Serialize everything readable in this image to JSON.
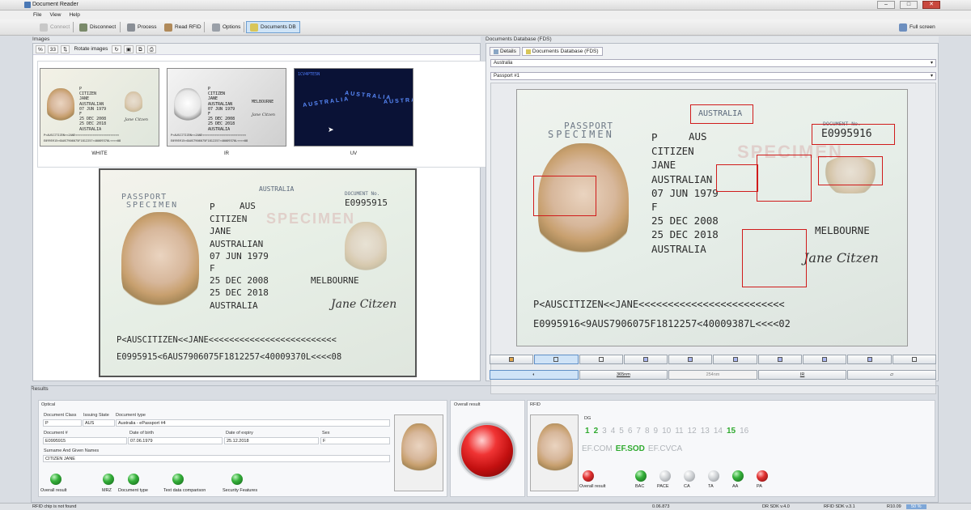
{
  "window": {
    "title": "Document Reader"
  },
  "menu": [
    "File",
    "View",
    "Help"
  ],
  "toolbar": {
    "connect": "Connect",
    "disconnect": "Disconnect",
    "process": "Process",
    "read_rfid": "Read RFID",
    "options": "Options",
    "documents_db": "Documents DB",
    "full_screen": "Full screen"
  },
  "images_panel": {
    "title": "Images",
    "tools": {
      "percent": "%",
      "zoom": "33",
      "rotate": "Rotate images"
    },
    "thumbnails": [
      {
        "caption": "WHITE"
      },
      {
        "caption": "IR"
      },
      {
        "caption": "UV"
      }
    ]
  },
  "passport": {
    "header": "PASSPORT",
    "specimen": "SPECIMEN",
    "country_box": "AUSTRALIA",
    "doc_no_label": "DOCUMENT No.",
    "type": "P",
    "issuing": "AUS",
    "surname": "CITIZEN",
    "given": "JANE",
    "nationality": "AUSTRALIAN",
    "dob": "07 JUN 1979",
    "sex": "F",
    "issue": "25 DEC 2008",
    "expiry": "25 DEC 2018",
    "authority": "AUSTRALIA",
    "birthplace": "MELBOURNE",
    "signature": "Jane Citzen",
    "watermark": "SPECIMEN",
    "uv_text": "AUSTRALIA",
    "uv_code": "1CV4PTE5N"
  },
  "passport_main": {
    "doc_no": "E0995915",
    "mrz1": "P<AUSCITIZEN<<JANE<<<<<<<<<<<<<<<<<<<<<<<<<",
    "mrz2": "E0995915<6AUS7906075F1812257<40009370L<<<<08"
  },
  "passport_db": {
    "doc_no": "E0995916",
    "mrz1": "P<AUSCITIZEN<<JANE<<<<<<<<<<<<<<<<<<<<<<<<<",
    "mrz2": "E0995916<9AUS7906075F1812257<40009387L<<<<02"
  },
  "db_panel": {
    "title": "Documents Database (FDS)",
    "tab_details": "Details",
    "tab_fds": "Documents Database (FDS)",
    "country": "Australia",
    "document": "Passport #1",
    "light_buttons": [
      "365nm",
      "254nm",
      "IR"
    ]
  },
  "results": {
    "title": "Results",
    "optical": {
      "title": "Optical",
      "doc_class_label": "Document Class",
      "issuing_state_label": "Issuing State",
      "doc_type_label": "Document type",
      "doc_class": "P",
      "issuing_state": "AUS",
      "doc_type": "Australia - ePassport #4",
      "doc_no_label": "Document #",
      "dob_label": "Date of birth",
      "expiry_label": "Date of expiry",
      "sex_label": "Sex",
      "doc_no": "E0995915",
      "dob": "07.06.1979",
      "expiry": "25.12.2018",
      "sex": "F",
      "name_label": "Surname And Given Names",
      "name": "CITIZEN JANE",
      "indicators": [
        "Overall result",
        "MRZ",
        "Document type",
        "Text data comparison",
        "Security Features"
      ]
    },
    "overall": {
      "title": "Overall result"
    },
    "rfid": {
      "title": "RFID",
      "dg_label": "DG",
      "dg": [
        {
          "n": "1",
          "on": true
        },
        {
          "n": "2",
          "on": true
        },
        {
          "n": "3",
          "on": false
        },
        {
          "n": "4",
          "on": false
        },
        {
          "n": "5",
          "on": false
        },
        {
          "n": "6",
          "on": false
        },
        {
          "n": "7",
          "on": false
        },
        {
          "n": "8",
          "on": false
        },
        {
          "n": "9",
          "on": false
        },
        {
          "n": "10",
          "on": false
        },
        {
          "n": "11",
          "on": false
        },
        {
          "n": "12",
          "on": false
        },
        {
          "n": "13",
          "on": false
        },
        {
          "n": "14",
          "on": false
        },
        {
          "n": "15",
          "on": true
        },
        {
          "n": "16",
          "on": false
        }
      ],
      "ef": [
        {
          "t": "EF.COM",
          "on": false
        },
        {
          "t": "EF.SOD",
          "on": true
        },
        {
          "t": "EF.CVCA",
          "on": false
        }
      ],
      "indicators": [
        "Overall result",
        "BAC",
        "PACE",
        "CA",
        "TA",
        "AA",
        "PA"
      ]
    }
  },
  "status": {
    "message": "RFID chip is not found",
    "time": "0.06.873",
    "dr_sdk": "DR SDK v.4.0",
    "rfid_sdk": "RFID SDK v.3.1",
    "rfid_ver": "R10.09",
    "percent": "50 %"
  },
  "colors": {
    "ok": "#2faa2f",
    "fail": "#d01b1b",
    "accent": "#5f8fc6"
  }
}
